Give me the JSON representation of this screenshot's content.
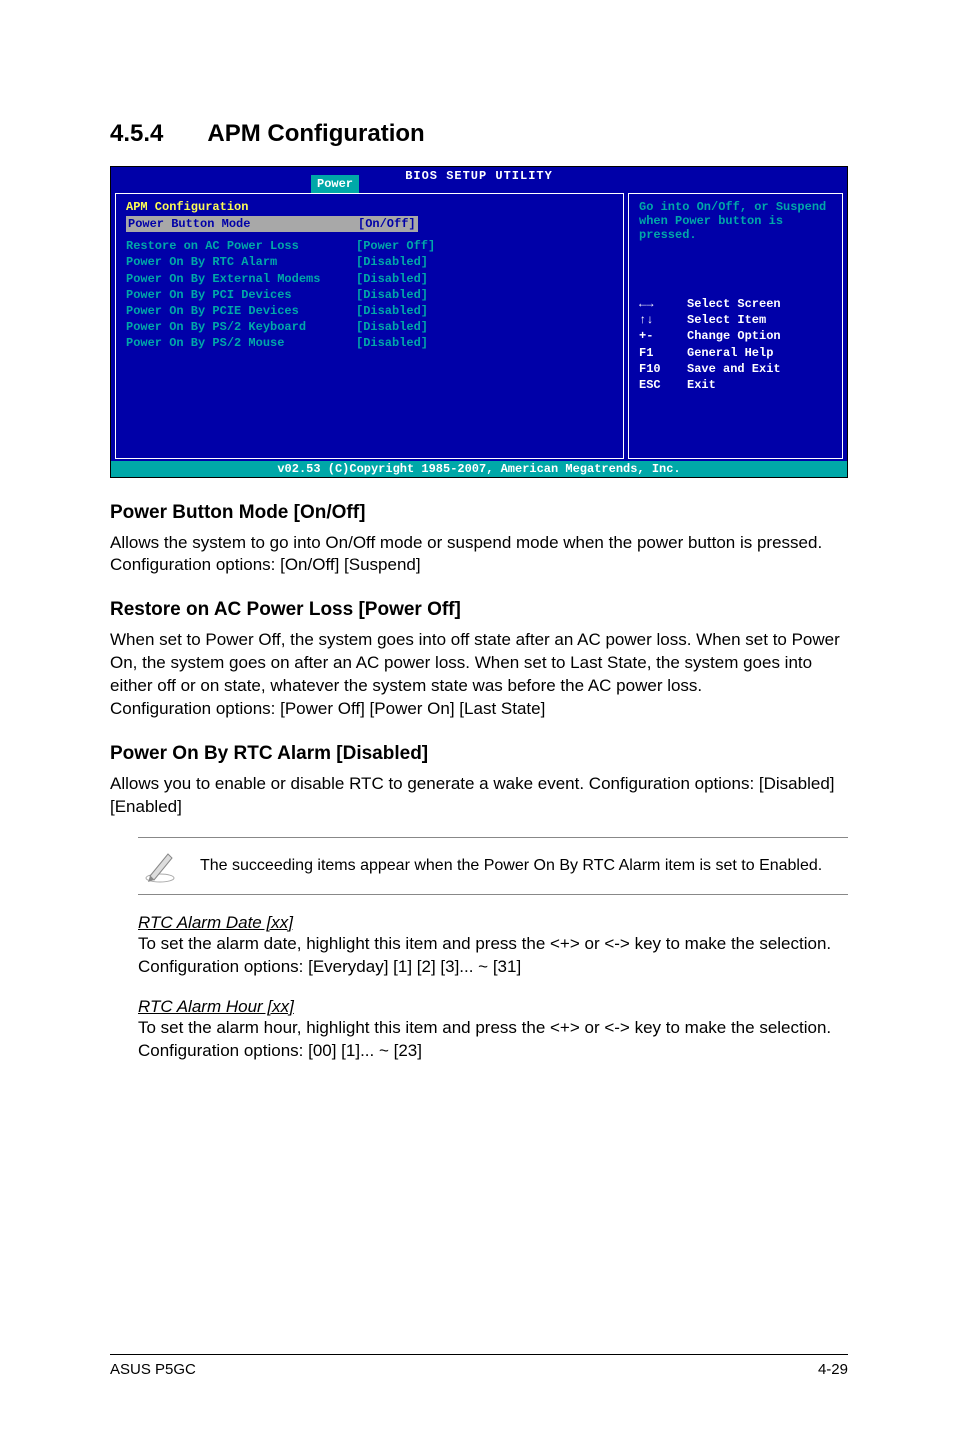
{
  "section": {
    "number": "4.5.4",
    "title": "APM Configuration"
  },
  "bios": {
    "header_title": "BIOS SETUP UTILITY",
    "tab": "Power",
    "left_heading": "APM Configuration",
    "rows": [
      {
        "label": "Power Button Mode",
        "value": "[On/Off]",
        "selected": true
      },
      {
        "label": "Restore on AC Power Loss",
        "value": "[Power Off]"
      },
      {
        "label": "Power On By RTC Alarm",
        "value": "[Disabled]"
      },
      {
        "label": "Power On By External Modems",
        "value": "[Disabled]"
      },
      {
        "label": "Power On By PCI Devices",
        "value": "[Disabled]"
      },
      {
        "label": "Power On By PCIE Devices",
        "value": "[Disabled]"
      },
      {
        "label": "Power On By PS/2 Keyboard",
        "value": "[Disabled]"
      },
      {
        "label": "Power On By PS/2 Mouse",
        "value": "[Disabled]"
      }
    ],
    "help_text": "Go into On/Off, or Suspend when Power button is pressed.",
    "keys": [
      {
        "sym": "←→",
        "desc": "Select Screen"
      },
      {
        "sym": "↑↓",
        "desc": "Select Item"
      },
      {
        "sym": "+-",
        "desc": "Change Option"
      },
      {
        "sym": "F1",
        "desc": "General Help"
      },
      {
        "sym": "F10",
        "desc": "Save and Exit"
      },
      {
        "sym": "ESC",
        "desc": "Exit"
      }
    ],
    "footer": "v02.53 (C)Copyright 1985-2007, American Megatrends, Inc."
  },
  "subsections": [
    {
      "title": "Power Button Mode [On/Off]",
      "body": "Allows the system to go into On/Off mode or suspend mode when the power button is pressed. Configuration options: [On/Off] [Suspend]"
    },
    {
      "title": "Restore on AC Power Loss [Power Off]",
      "body": "When set to Power Off, the system goes into off state after an AC power loss. When set to Power On, the system goes on after an AC power loss. When set to Last State, the system goes into either off or on state, whatever the system state was before the AC power loss.\nConfiguration options: [Power Off] [Power On] [Last State]"
    },
    {
      "title": "Power On By RTC Alarm [Disabled]",
      "body": "Allows you to enable or disable RTC to generate a wake event. Configuration options: [Disabled] [Enabled]"
    }
  ],
  "note": "The succeeding items appear when the Power On By RTC Alarm item is set to Enabled.",
  "sub_items": [
    {
      "title": "RTC Alarm Date [xx]",
      "body": "To set the alarm date, highlight this item and press the <+> or <-> key to make the selection. Configuration options: [Everyday] [1] [2] [3]... ~ [31]"
    },
    {
      "title": "RTC Alarm Hour [xx]",
      "body": "To set the alarm hour, highlight this item and press the <+> or <-> key to make the selection. Configuration options: [00] [1]... ~ [23]"
    }
  ],
  "footer": {
    "left": "ASUS P5GC",
    "right": "4-29"
  }
}
